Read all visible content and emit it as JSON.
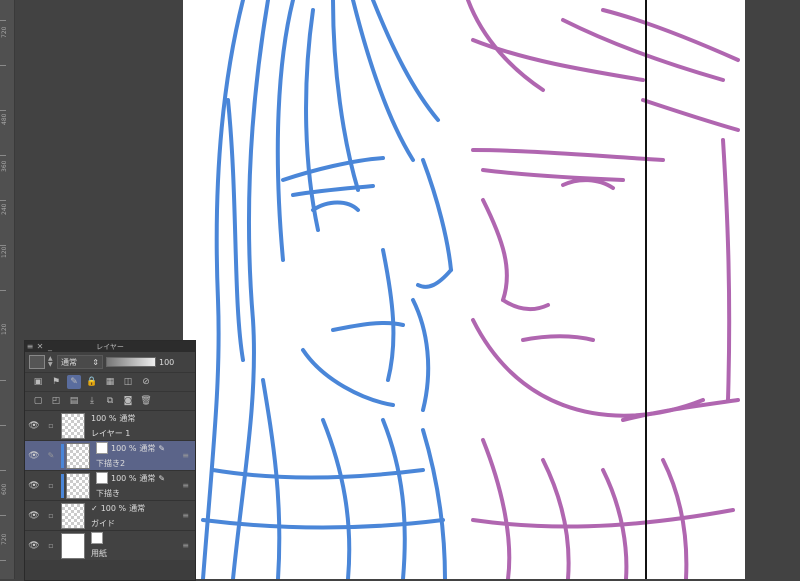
{
  "ruler": {
    "labels": [
      "720",
      "480",
      "360",
      "240",
      "120",
      "120",
      "600",
      "720"
    ]
  },
  "panel": {
    "title": "レイヤー",
    "blend_mode": "通常",
    "opacity_value": "100"
  },
  "layers": [
    {
      "opacity": "100 %",
      "mode": "通常",
      "name": "レイヤー 1"
    },
    {
      "opacity": "100 %",
      "mode": "通常",
      "name": "下描き2"
    },
    {
      "opacity": "100 %",
      "mode": "通常",
      "name": "下描き"
    },
    {
      "opacity": "100 %",
      "mode": "通常",
      "name": "ガイド"
    },
    {
      "opacity": "",
      "mode": "",
      "name": "用紙"
    }
  ],
  "colors": {
    "blue_sketch": "#4a86d8",
    "purple_sketch": "#b066b0",
    "selected_layer": "#5b6489"
  }
}
